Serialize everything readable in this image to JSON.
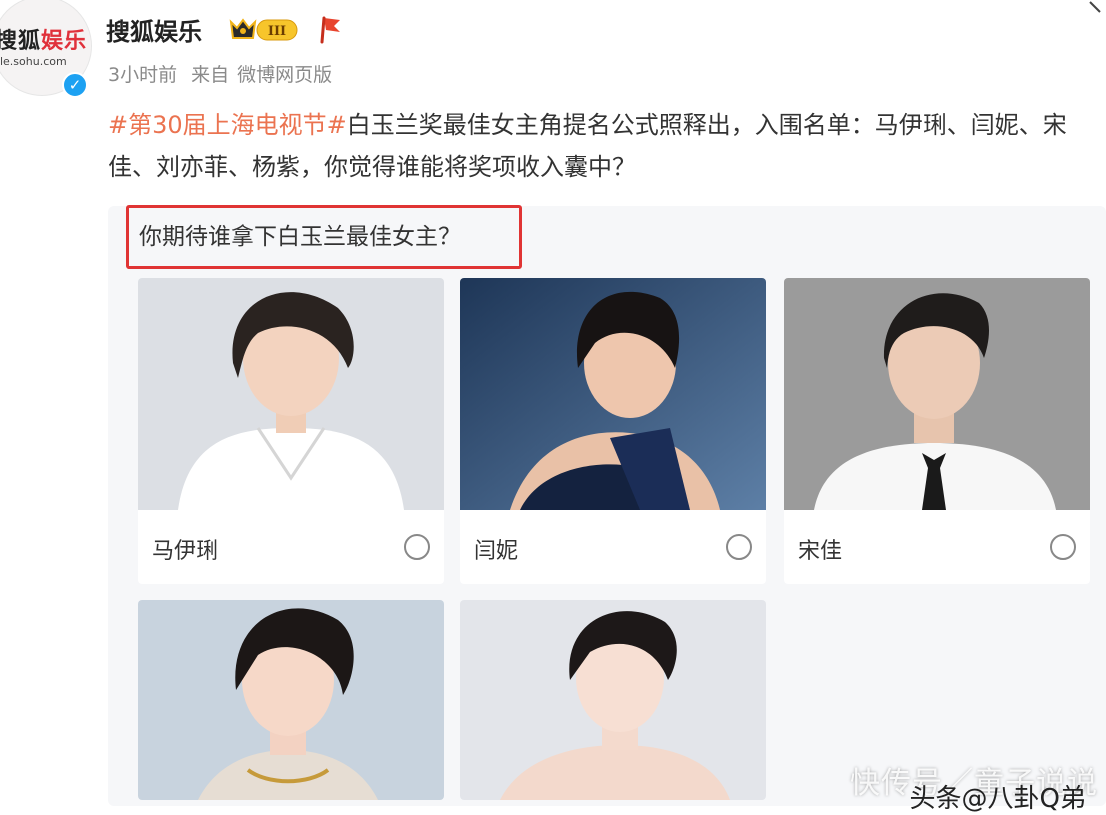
{
  "account": {
    "name": "搜狐娱乐",
    "avatar_logo_main": "搜狐",
    "avatar_logo_accent": "娱乐",
    "avatar_logo_url": "ule.sohu.com",
    "verified_mark": "✓",
    "level_badge": "III"
  },
  "meta": {
    "time": "3小时前",
    "source_prefix": "来自",
    "source": "微博网页版"
  },
  "post": {
    "topic": "#第30届上海电视节#",
    "text": "白玉兰奖最佳女主角提名公式照释出，入围名单：马伊琍、闫妮、宋佳、刘亦菲、杨紫，你觉得谁能将奖项收入囊中？"
  },
  "poll": {
    "question": "你期待谁拿下白玉兰最佳女主？",
    "options": [
      {
        "name": "马伊琍",
        "bg": "#dcdfe4"
      },
      {
        "name": "闫妮",
        "bg": "#2e4b73"
      },
      {
        "name": "宋佳",
        "bg": "#9a9a9a"
      },
      {
        "name": "",
        "bg": "#c8d3de"
      },
      {
        "name": "",
        "bg": "#e3e5ea"
      }
    ]
  },
  "colors": {
    "topic": "#eb7350",
    "highlight_box": "#e03434",
    "verified": "#1da1f2"
  },
  "watermark": {
    "line1": "快传号／童子说说",
    "line2": "头条@八卦Q弟"
  }
}
